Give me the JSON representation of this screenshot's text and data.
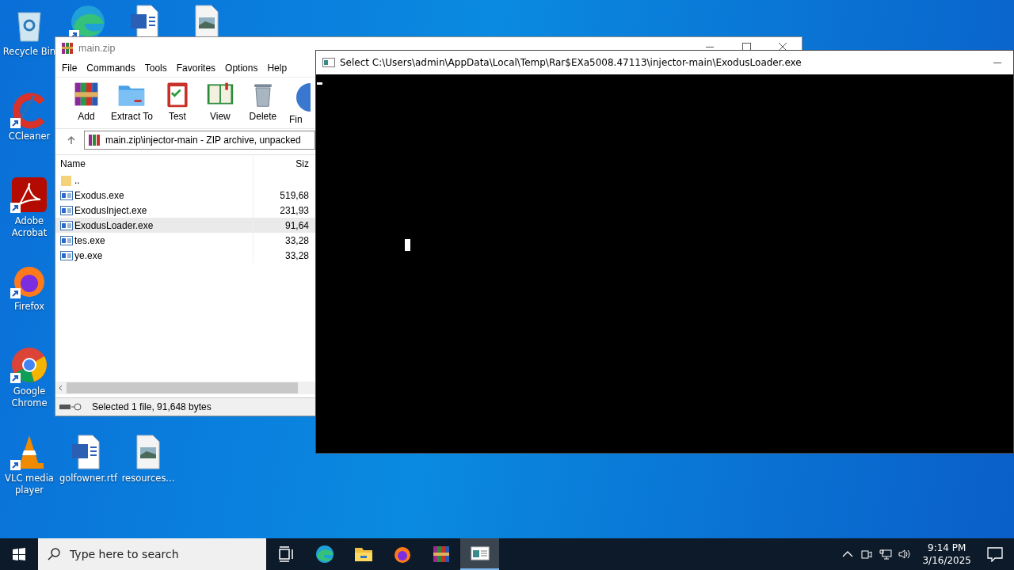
{
  "desktop_icons": [
    {
      "kind": "recycle",
      "label": "Recycle Bin",
      "shortcut": false
    },
    {
      "kind": "ccleaner",
      "label": "CCleaner",
      "shortcut": true
    },
    {
      "kind": "acrobat",
      "label": "Adobe Acrobat",
      "shortcut": true
    },
    {
      "kind": "firefox",
      "label": "Firefox",
      "shortcut": true
    },
    {
      "kind": "chrome",
      "label": "Google Chrome",
      "shortcut": true
    },
    {
      "kind": "vlc",
      "label": "VLC media player",
      "shortcut": true
    },
    {
      "kind": "word",
      "label": "golfowner.rtf",
      "shortcut": false
    },
    {
      "kind": "image",
      "label": "resources...",
      "shortcut": false
    },
    {
      "kind": "edge",
      "shortcut": true
    },
    {
      "kind": "word",
      "shortcut": false
    },
    {
      "kind": "image",
      "shortcut": false
    }
  ],
  "winrar": {
    "title": "main.zip",
    "menu": [
      "File",
      "Commands",
      "Tools",
      "Favorites",
      "Options",
      "Help"
    ],
    "toolbar": [
      {
        "kind": "add",
        "label": "Add"
      },
      {
        "kind": "extract",
        "label": "Extract To"
      },
      {
        "kind": "test",
        "label": "Test"
      },
      {
        "kind": "view",
        "label": "View"
      },
      {
        "kind": "delete",
        "label": "Delete"
      },
      {
        "kind": "find",
        "label": "Fin"
      }
    ],
    "path": "main.zip\\injector-main - ZIP archive, unpacked",
    "columns": [
      "Name",
      "Siz"
    ],
    "rows": [
      {
        "kind": "folder",
        "name": "..",
        "size": "",
        "selected": false
      },
      {
        "kind": "exe",
        "name": "Exodus.exe",
        "size": "519,68",
        "selected": false
      },
      {
        "kind": "exe",
        "name": "ExodusInject.exe",
        "size": "231,93",
        "selected": false
      },
      {
        "kind": "exe",
        "name": "ExodusLoader.exe",
        "size": "91,64",
        "selected": true
      },
      {
        "kind": "exe",
        "name": "tes.exe",
        "size": "33,28",
        "selected": false
      },
      {
        "kind": "exe",
        "name": "ye.exe",
        "size": "33,28",
        "selected": false
      }
    ],
    "status": "Selected 1 file, 91,648 bytes"
  },
  "console": {
    "title": "Select C:\\Users\\admin\\AppData\\Local\\Temp\\Rar$EXa5008.47113\\injector-main\\ExodusLoader.exe"
  },
  "taskbar": {
    "search_placeholder": "Type here to search",
    "apps": [
      {
        "kind": "taskview",
        "active": false
      },
      {
        "kind": "edge",
        "active": false
      },
      {
        "kind": "explorer",
        "active": false
      },
      {
        "kind": "firefox",
        "active": false
      },
      {
        "kind": "winrar",
        "active": false
      },
      {
        "kind": "console",
        "active": true
      }
    ],
    "time": "9:14 PM",
    "date": "3/16/2025"
  }
}
